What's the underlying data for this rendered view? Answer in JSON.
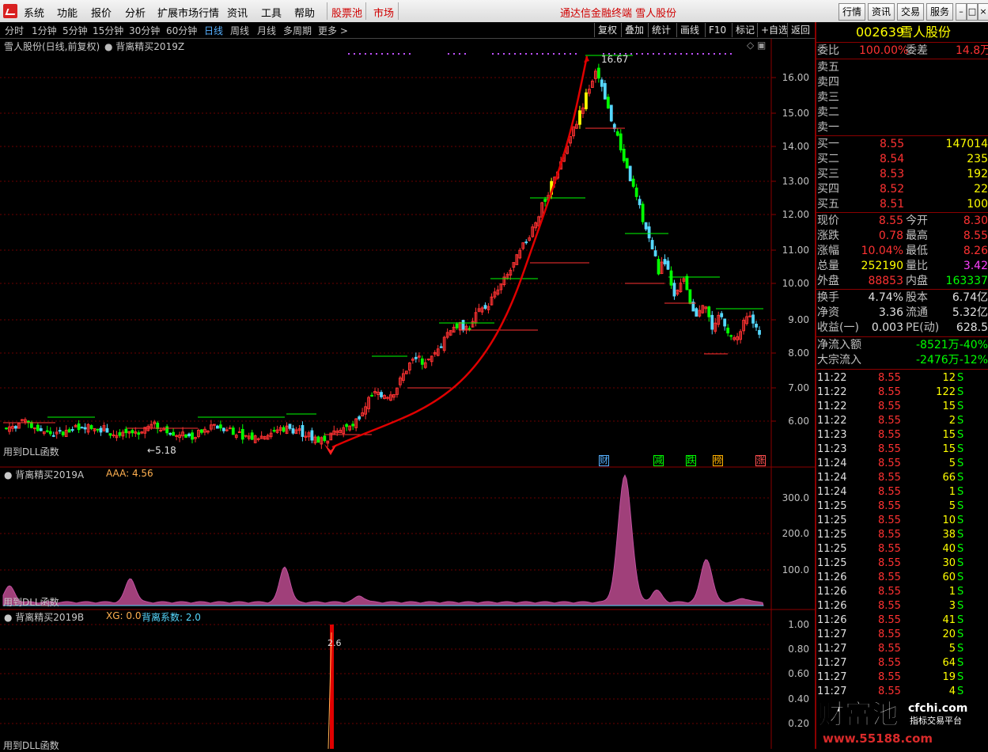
{
  "menu": {
    "items": [
      "系统",
      "功能",
      "报价",
      "分析",
      "扩展市场行情",
      "资讯",
      "工具",
      "帮助"
    ],
    "highlight": [
      "股票池",
      "市场"
    ],
    "title": "通达信金融终端  雪人股份",
    "right_buttons": [
      "行情",
      "资讯",
      "交易",
      "服务"
    ],
    "window_controls": [
      "–",
      "□",
      "×"
    ]
  },
  "periods": {
    "items": [
      "分时",
      "1分钟",
      "5分钟",
      "15分钟",
      "30分钟",
      "60分钟",
      "日线",
      "周线",
      "月线",
      "多周期",
      "更多 >"
    ],
    "active": "日线",
    "tools": [
      "复权",
      "叠加",
      "统计",
      "画线",
      "F10",
      "标记",
      "+自选",
      "返回"
    ]
  },
  "main_chart": {
    "header": "雪人股份(日线,前复权)",
    "indicator": "背离精买2019Z",
    "footer": "用到DLL函数",
    "high_label": "16.67",
    "low_label": "5.18",
    "y_ticks": [
      "16.00",
      "15.00",
      "14.00",
      "13.00",
      "12.00",
      "11.00",
      "10.00",
      "9.00",
      "8.00",
      "7.00",
      "6.00"
    ],
    "badges": [
      "财",
      "减",
      "跌",
      "榜",
      "涨"
    ],
    "colors": {
      "up": "#ff3232",
      "down": "#00ff00",
      "flat": "#56d8ff",
      "signal": "#ffff00",
      "grid": "#6b0000"
    }
  },
  "sub_a": {
    "name": "背离精买2019A",
    "value_label": "AAA: 4.56",
    "footer": "用到DLL函数",
    "y_ticks": [
      "300.0",
      "200.0",
      "100.0"
    ]
  },
  "sub_b": {
    "name": "背离精买2019B",
    "xg_label": "XG: 0.0",
    "coef_label": "背离系数: 2.0",
    "peak_label": "2.6",
    "footer": "用到DLL函数",
    "y_ticks": [
      "1.00",
      "0.80",
      "0.60",
      "0.40",
      "0.20"
    ]
  },
  "quote": {
    "code": "002639",
    "name": "雪人股份",
    "weibi_label": "委比",
    "weibi": "100.00%",
    "weicha_label": "委差",
    "weicha": "14.8万",
    "sell": [
      "卖五",
      "卖四",
      "卖三",
      "卖二",
      "卖一"
    ],
    "buy": [
      {
        "label": "买一",
        "price": "8.55",
        "vol": "147014"
      },
      {
        "label": "买二",
        "price": "8.54",
        "vol": "235"
      },
      {
        "label": "买三",
        "price": "8.53",
        "vol": "192"
      },
      {
        "label": "买四",
        "price": "8.52",
        "vol": "22"
      },
      {
        "label": "买五",
        "price": "8.51",
        "vol": "100"
      }
    ],
    "stats": [
      {
        "l1": "现价",
        "v1": "8.55",
        "l2": "今开",
        "v2": "8.30",
        "c1": "#ff3232",
        "c2": "#ff3232"
      },
      {
        "l1": "涨跌",
        "v1": "0.78",
        "l2": "最高",
        "v2": "8.55",
        "c1": "#ff3232",
        "c2": "#ff3232"
      },
      {
        "l1": "涨幅",
        "v1": "10.04%",
        "l2": "最低",
        "v2": "8.26",
        "c1": "#ff3232",
        "c2": "#ff3232"
      },
      {
        "l1": "总量",
        "v1": "252190",
        "l2": "量比",
        "v2": "3.42",
        "c1": "#ffff00",
        "c2": "#ff40ff"
      },
      {
        "l1": "外盘",
        "v1": "88853",
        "l2": "内盘",
        "v2": "163337",
        "c1": "#ff3232",
        "c2": "#00ff00"
      }
    ],
    "stats2": [
      {
        "l1": "换手",
        "v1": "4.74%",
        "l2": "股本",
        "v2": "6.74亿"
      },
      {
        "l1": "净资",
        "v1": "3.36",
        "l2": "流通",
        "v2": "5.32亿"
      },
      {
        "l1": "收益(一)",
        "v1": "0.003",
        "l2": "PE(动)",
        "v2": "628.5"
      }
    ],
    "flows": [
      {
        "label": "净流入额",
        "value": "-8521万",
        "pct": "-40%"
      },
      {
        "label": "大宗流入",
        "value": "-2476万",
        "pct": "-12%"
      }
    ],
    "ticks": [
      [
        "11:22",
        "8.55",
        "12",
        "S"
      ],
      [
        "11:22",
        "8.55",
        "122",
        "S"
      ],
      [
        "11:22",
        "8.55",
        "15",
        "S"
      ],
      [
        "11:22",
        "8.55",
        "2",
        "S"
      ],
      [
        "11:23",
        "8.55",
        "15",
        "S"
      ],
      [
        "11:23",
        "8.55",
        "15",
        "S"
      ],
      [
        "11:24",
        "8.55",
        "5",
        "S"
      ],
      [
        "11:24",
        "8.55",
        "66",
        "S"
      ],
      [
        "11:24",
        "8.55",
        "1",
        "S"
      ],
      [
        "11:25",
        "8.55",
        "5",
        "S"
      ],
      [
        "11:25",
        "8.55",
        "10",
        "S"
      ],
      [
        "11:25",
        "8.55",
        "38",
        "S"
      ],
      [
        "11:25",
        "8.55",
        "40",
        "S"
      ],
      [
        "11:25",
        "8.55",
        "30",
        "S"
      ],
      [
        "11:26",
        "8.55",
        "60",
        "S"
      ],
      [
        "11:26",
        "8.55",
        "1",
        "S"
      ],
      [
        "11:26",
        "8.55",
        "3",
        "S"
      ],
      [
        "11:26",
        "8.55",
        "41",
        "S"
      ],
      [
        "11:27",
        "8.55",
        "20",
        "S"
      ],
      [
        "11:27",
        "8.55",
        "5",
        "S"
      ],
      [
        "11:27",
        "8.55",
        "64",
        "S"
      ],
      [
        "11:27",
        "8.55",
        "19",
        "S"
      ],
      [
        "11:27",
        "8.55",
        "4",
        "S"
      ]
    ]
  },
  "watermark": {
    "brand": "财富池",
    "site": "cfchi.com",
    "slogan": "指标交易平台"
  }
}
